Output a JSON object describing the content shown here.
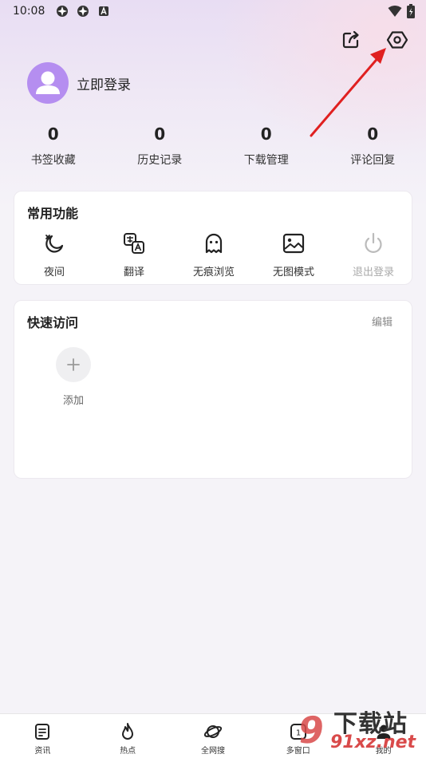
{
  "status_bar": {
    "time": "10:08"
  },
  "profile": {
    "login_label": "立即登录"
  },
  "stats": [
    {
      "value": "0",
      "label": "书签收藏"
    },
    {
      "value": "0",
      "label": "历史记录"
    },
    {
      "value": "0",
      "label": "下载管理"
    },
    {
      "value": "0",
      "label": "评论回复"
    }
  ],
  "common_functions": {
    "title": "常用功能",
    "items": [
      {
        "label": "夜间",
        "icon": "moon-icon"
      },
      {
        "label": "翻译",
        "icon": "translate-icon"
      },
      {
        "label": "无痕浏览",
        "icon": "ghost-icon"
      },
      {
        "label": "无图模式",
        "icon": "no-image-icon"
      },
      {
        "label": "退出登录",
        "icon": "power-icon"
      }
    ]
  },
  "quick_access": {
    "title": "快速访问",
    "edit_label": "编辑",
    "add_label": "添加"
  },
  "bottom_nav": [
    {
      "label": "资讯",
      "icon": "news-icon"
    },
    {
      "label": "热点",
      "icon": "flame-icon"
    },
    {
      "label": "全网搜",
      "icon": "planet-icon"
    },
    {
      "label": "多窗口",
      "icon": "windows-icon",
      "badge": "1"
    },
    {
      "label": "我的",
      "icon": "person-icon"
    }
  ],
  "watermark": {
    "title": "下载站",
    "site": "91xz.net"
  },
  "colors": {
    "accent": "#b58ef0",
    "arrow": "#e02020"
  }
}
